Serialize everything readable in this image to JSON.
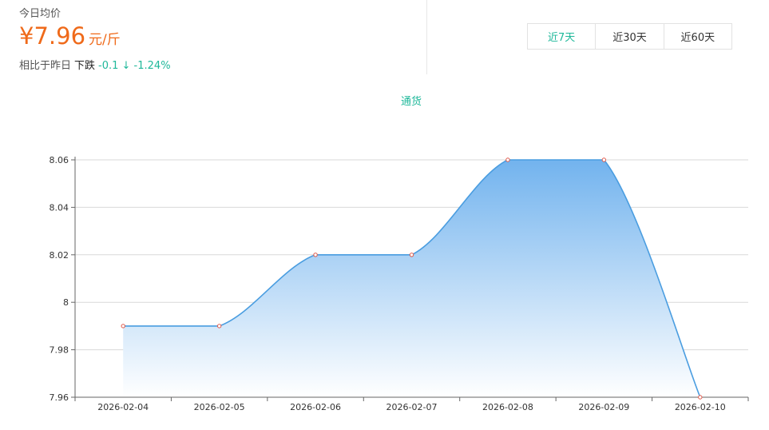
{
  "price_panel": {
    "title": "今日均价",
    "value": "¥7.96",
    "unit": "元/斤",
    "change_label": "相比于昨日",
    "change_trend": "下跌",
    "change_value": "-0.1 ↓ -1.24%"
  },
  "range_tabs": [
    {
      "label": "近7天",
      "active": true
    },
    {
      "label": "近30天",
      "active": false
    },
    {
      "label": "近60天",
      "active": false
    }
  ],
  "colors": {
    "accent": "#1fb89a",
    "price": "#ef6a1a",
    "line": "#4a9de0",
    "area_top": "#72b3ee",
    "point": "#e0594a"
  },
  "chart_data": {
    "type": "area",
    "title": "通货",
    "categories": [
      "2026-02-04",
      "2026-02-05",
      "2026-02-06",
      "2026-02-07",
      "2026-02-08",
      "2026-02-09",
      "2026-02-10"
    ],
    "series": [
      {
        "name": "通货",
        "values": [
          7.99,
          7.99,
          8.02,
          8.02,
          8.06,
          8.06,
          7.96
        ]
      }
    ],
    "ylim": [
      7.96,
      8.06
    ],
    "yticks": [
      7.96,
      7.98,
      8,
      8.02,
      8.04,
      8.06
    ],
    "ytick_labels": [
      "7.96",
      "7.98",
      "8",
      "8.02",
      "8.04",
      "8.06"
    ],
    "grid": true,
    "smooth": true,
    "gradient_fill": true
  }
}
